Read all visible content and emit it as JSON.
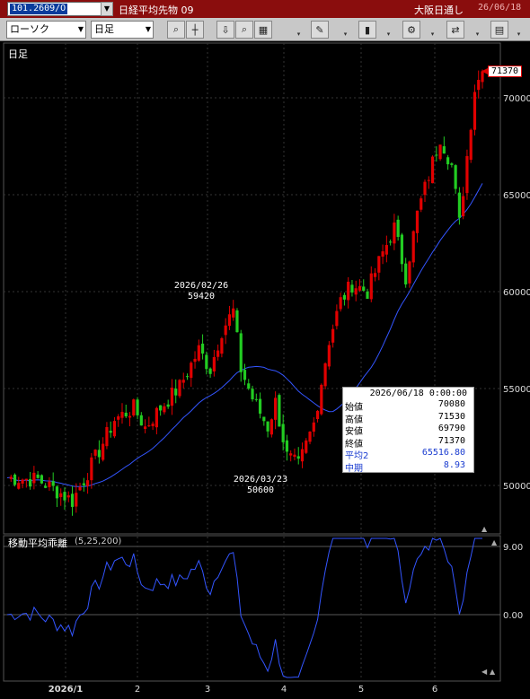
{
  "titlebar": {
    "code": "101.2609/O",
    "name": "日経平均先物 09",
    "source": "大阪日通し",
    "date": "26/06/18"
  },
  "toolbar": {
    "chart_type": "ローソク",
    "period": "日足",
    "icons": [
      "zoom-icon",
      "crosshair-icon",
      "download-icon",
      "search-chart-icon",
      "table-icon",
      "edit-pen-icon",
      "candle-style-icon",
      "settings-gear-icon",
      "compare-icon",
      "layout-icon"
    ]
  },
  "main_panel": {
    "label": "日足",
    "high_annotation": {
      "date": "2026/02/26",
      "value": "59420"
    },
    "low_annotation": {
      "date": "2026/03/23",
      "value": "50600"
    },
    "last_price": "71370",
    "y_ticks": [
      "70000",
      "65000",
      "60000",
      "55000",
      "50000"
    ],
    "info": {
      "datetime": "2026/06/18 0:00:00",
      "rows": [
        {
          "key": "始値",
          "value": "70080",
          "blue": false
        },
        {
          "key": "高値",
          "value": "71530",
          "blue": false
        },
        {
          "key": "安値",
          "value": "69790",
          "blue": false
        },
        {
          "key": "終値",
          "value": "71370",
          "blue": false
        },
        {
          "key": "平均2",
          "value": "65516.80",
          "blue": true
        },
        {
          "key": "中期",
          "value": "8.93",
          "blue": true
        }
      ]
    }
  },
  "osc_panel": {
    "label": "移動平均乖離",
    "params": "(5,25,200)",
    "y_ticks": [
      "9.00",
      "0.00"
    ]
  },
  "x_axis": {
    "ticks": [
      "2026/1",
      "2",
      "3",
      "4",
      "5",
      "6"
    ]
  },
  "colors": {
    "up": "#e00000",
    "down": "#22cc22",
    "ma": "#3355ff",
    "osc": "#3355ff"
  },
  "chart_data": {
    "type": "candlestick",
    "ylim": [
      48000,
      73000
    ],
    "ma_series_name": "平均2",
    "osc_ylim": [
      -15,
      15
    ],
    "osc_series_name": "中期"
  }
}
